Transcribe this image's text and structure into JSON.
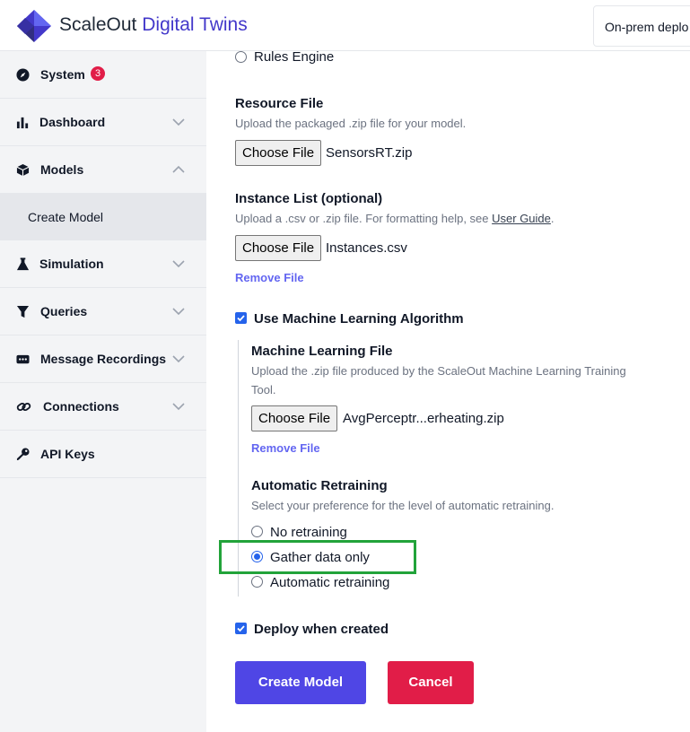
{
  "header": {
    "brand_part1": "ScaleOut",
    "brand_part2": "Digital Twins",
    "deployment_label": "On-prem deplo"
  },
  "sidebar": {
    "items": [
      {
        "label": "System",
        "icon": "compass-icon",
        "badge": "3"
      },
      {
        "label": "Dashboard",
        "icon": "bar-chart-icon"
      },
      {
        "label": "Models",
        "icon": "cube-icon"
      },
      {
        "label": "Create Model"
      },
      {
        "label": "Simulation",
        "icon": "flask-icon"
      },
      {
        "label": "Queries",
        "icon": "filter-icon"
      },
      {
        "label": "Message Recordings",
        "icon": "message-icon"
      },
      {
        "label": "Connections",
        "icon": "link-icon"
      },
      {
        "label": "API Keys",
        "icon": "key-icon"
      }
    ]
  },
  "form": {
    "rules_engine_label": "Rules Engine",
    "resource_file": {
      "label": "Resource File",
      "help": "Upload the packaged .zip file for your model.",
      "button": "Choose File",
      "file_name": "SensorsRT.zip"
    },
    "instance_list": {
      "label": "Instance List (optional)",
      "help_prefix": "Upload a .csv or .zip file. For formatting help, see ",
      "help_link": "User Guide",
      "help_suffix": ".",
      "button": "Choose File",
      "file_name": "Instances.csv",
      "remove": "Remove File"
    },
    "use_ml": {
      "label": "Use Machine Learning Algorithm",
      "checked": true
    },
    "ml_file": {
      "label": "Machine Learning File",
      "help_line1": "Upload the .zip file produced by the ScaleOut Machine Learning Training",
      "help_line2": "Tool.",
      "button": "Choose File",
      "file_name": "AvgPerceptr...erheating.zip",
      "remove": "Remove File"
    },
    "retraining": {
      "label": "Automatic Retraining",
      "help": "Select your preference for the level of automatic retraining.",
      "options": [
        "No retraining",
        "Gather data only",
        "Automatic retraining"
      ],
      "selected": "Gather data only"
    },
    "deploy": {
      "label": "Deploy when created",
      "checked": true
    },
    "create_button": "Create Model",
    "cancel_button": "Cancel"
  },
  "colors": {
    "accent": "#4f46e5",
    "danger": "#e11d48",
    "highlight_box": "#22a33a"
  }
}
